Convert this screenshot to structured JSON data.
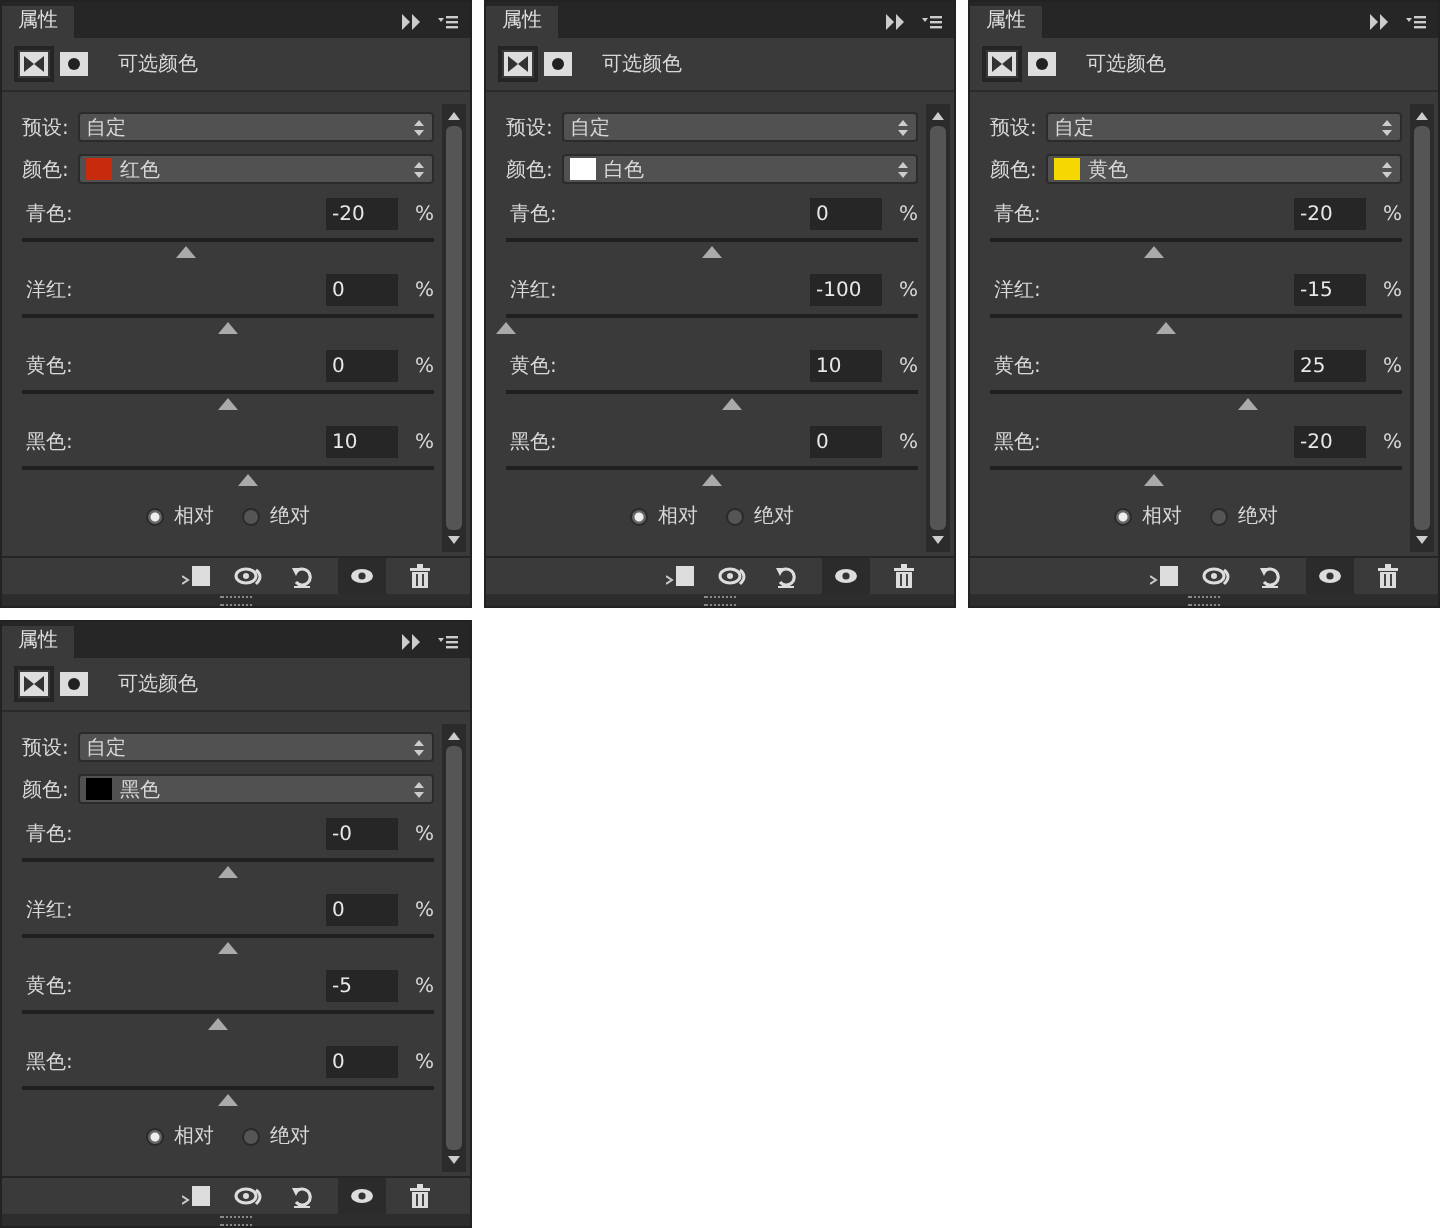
{
  "panels": [
    {
      "tab": "属性",
      "adjustment": "可选颜色",
      "preset": {
        "label": "预设:",
        "value": "自定"
      },
      "colors": {
        "label": "颜色:",
        "value": "红色",
        "color": "#c82a0e"
      },
      "sliders": [
        {
          "label": "青色:",
          "value": "-20",
          "unit": "%",
          "level": 0.4
        },
        {
          "label": "洋红:",
          "value": "0",
          "unit": "%",
          "level": 0.5
        },
        {
          "label": "黄色:",
          "value": "0",
          "unit": "%",
          "level": 0.5
        },
        {
          "label": "黑色:",
          "value": "10",
          "unit": "%",
          "level": 0.55
        }
      ],
      "modes": [
        {
          "label": "相对",
          "selected": true
        },
        {
          "label": "绝对",
          "selected": false
        }
      ]
    },
    {
      "tab": "属性",
      "adjustment": "可选颜色",
      "preset": {
        "label": "预设:",
        "value": "自定"
      },
      "colors": {
        "label": "颜色:",
        "value": "白色",
        "color": "#ffffff"
      },
      "sliders": [
        {
          "label": "青色:",
          "value": "0",
          "unit": "%",
          "level": 0.5
        },
        {
          "label": "洋红:",
          "value": "-100",
          "unit": "%",
          "level": 0
        },
        {
          "label": "黄色:",
          "value": "10",
          "unit": "%",
          "level": 0.55
        },
        {
          "label": "黑色:",
          "value": "0",
          "unit": "%",
          "level": 0.5
        }
      ],
      "modes": [
        {
          "label": "相对",
          "selected": true
        },
        {
          "label": "绝对",
          "selected": false
        }
      ]
    },
    {
      "tab": "属性",
      "adjustment": "可选颜色",
      "preset": {
        "label": "预设:",
        "value": "自定"
      },
      "colors": {
        "label": "颜色:",
        "value": "黄色",
        "color": "#f5d800"
      },
      "sliders": [
        {
          "label": "青色:",
          "value": "-20",
          "unit": "%",
          "level": 0.4
        },
        {
          "label": "洋红:",
          "value": "-15",
          "unit": "%",
          "level": 0.425
        },
        {
          "label": "黄色:",
          "value": "25",
          "unit": "%",
          "level": 0.625
        },
        {
          "label": "黑色:",
          "value": "-20",
          "unit": "%",
          "level": 0.4
        }
      ],
      "modes": [
        {
          "label": "相对",
          "selected": true
        },
        {
          "label": "绝对",
          "selected": false
        }
      ]
    },
    {
      "tab": "属性",
      "adjustment": "可选颜色",
      "preset": {
        "label": "预设:",
        "value": "自定"
      },
      "colors": {
        "label": "颜色:",
        "value": "黑色",
        "color": "#000000"
      },
      "sliders": [
        {
          "label": "青色:",
          "value": "-0",
          "unit": "%",
          "level": 0.5
        },
        {
          "label": "洋红:",
          "value": "0",
          "unit": "%",
          "level": 0.5
        },
        {
          "label": "黄色:",
          "value": "-5",
          "unit": "%",
          "level": 0.475
        },
        {
          "label": "黑色:",
          "value": "0",
          "unit": "%",
          "level": 0.5
        }
      ],
      "modes": [
        {
          "label": "相对",
          "selected": true
        },
        {
          "label": "绝对",
          "selected": false
        }
      ]
    }
  ]
}
